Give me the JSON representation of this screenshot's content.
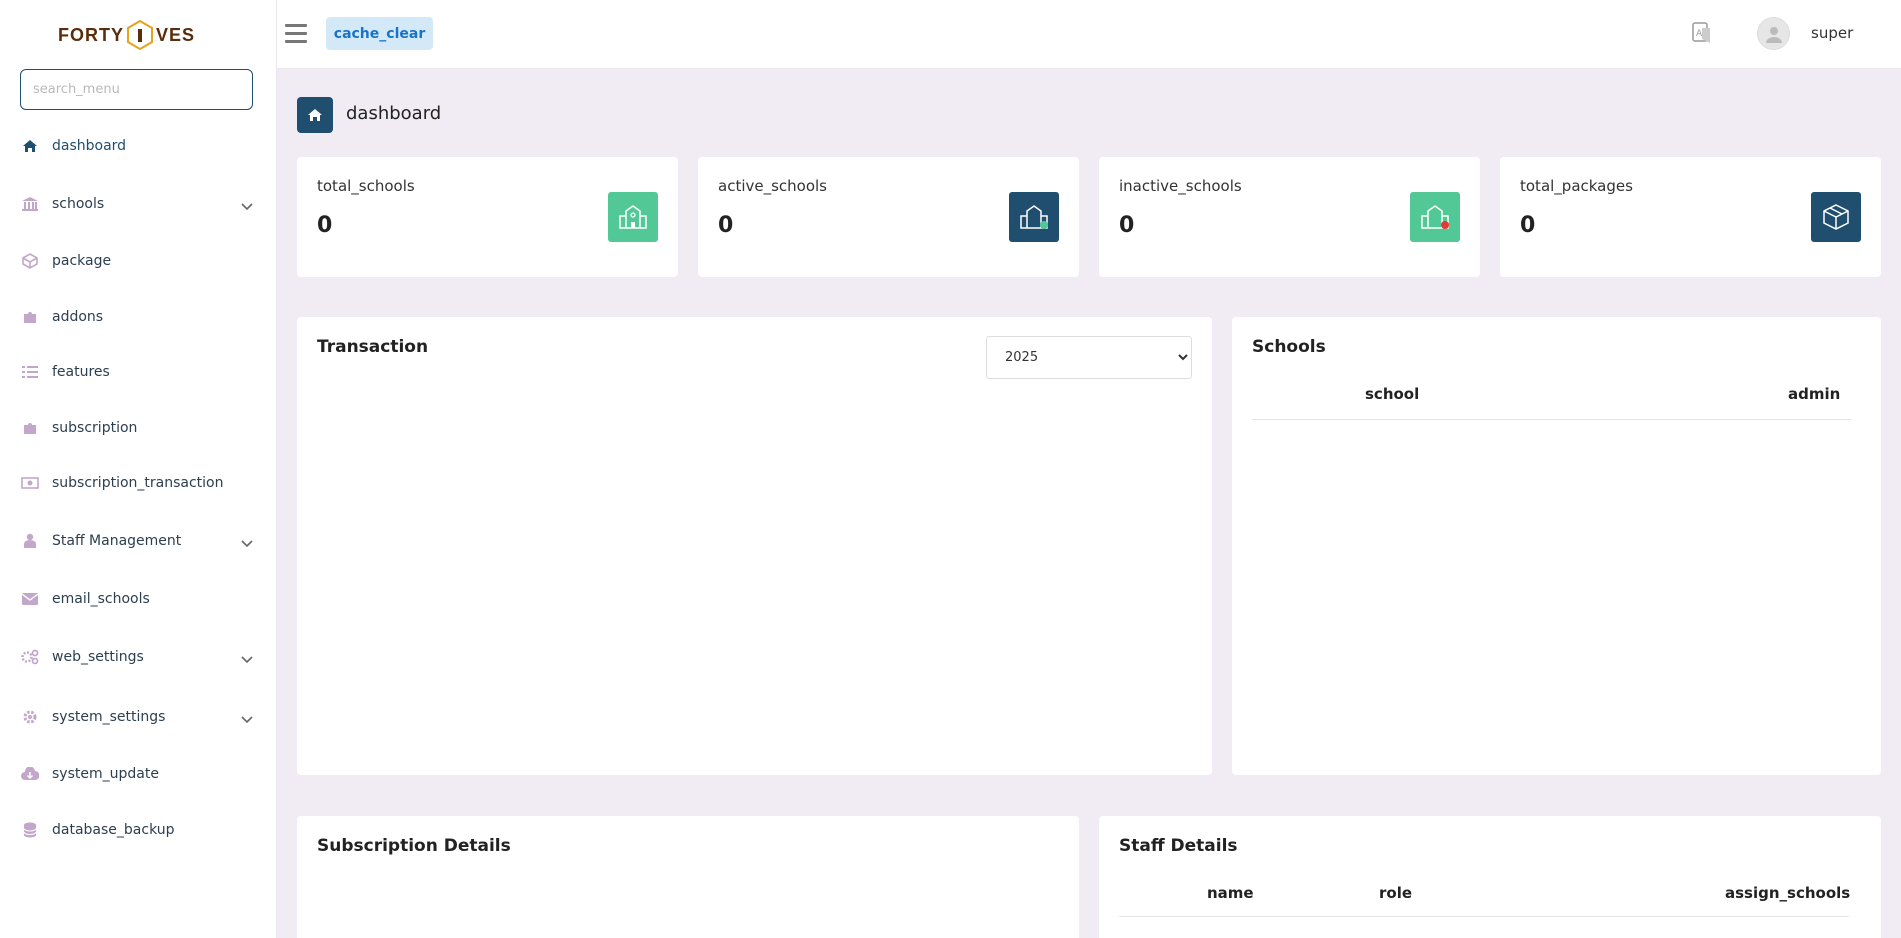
{
  "brand": {
    "logo_left": "FORTY",
    "logo_mid": "I",
    "logo_right": "VES"
  },
  "sidebar": {
    "search_placeholder": "search_menu",
    "items": [
      {
        "label": "dashboard"
      },
      {
        "label": "schools"
      },
      {
        "label": "package"
      },
      {
        "label": "addons"
      },
      {
        "label": "features"
      },
      {
        "label": "subscription"
      },
      {
        "label": "subscription_transaction"
      },
      {
        "label": "Staff Management"
      },
      {
        "label": "email_schools"
      },
      {
        "label": "web_settings"
      },
      {
        "label": "system_settings"
      },
      {
        "label": "system_update"
      },
      {
        "label": "database_backup"
      }
    ]
  },
  "topbar": {
    "cache_label": "cache_clear",
    "username": "super"
  },
  "page": {
    "title": "dashboard"
  },
  "stats": [
    {
      "label": "total_schools",
      "value": "0",
      "color": "#52c896"
    },
    {
      "label": "active_schools",
      "value": "0",
      "color": "#1f4e6e"
    },
    {
      "label": "inactive_schools",
      "value": "0",
      "color": "#52c896"
    },
    {
      "label": "total_packages",
      "value": "0",
      "color": "#1f4e6e"
    }
  ],
  "transaction": {
    "title": "Transaction",
    "year": "2025"
  },
  "schools_panel": {
    "title": "Schools",
    "columns": [
      "school",
      "admin"
    ]
  },
  "subscription_panel": {
    "title": "Subscription Details"
  },
  "staff_panel": {
    "title": "Staff Details",
    "columns": [
      "name",
      "role",
      "assign_schools"
    ]
  }
}
